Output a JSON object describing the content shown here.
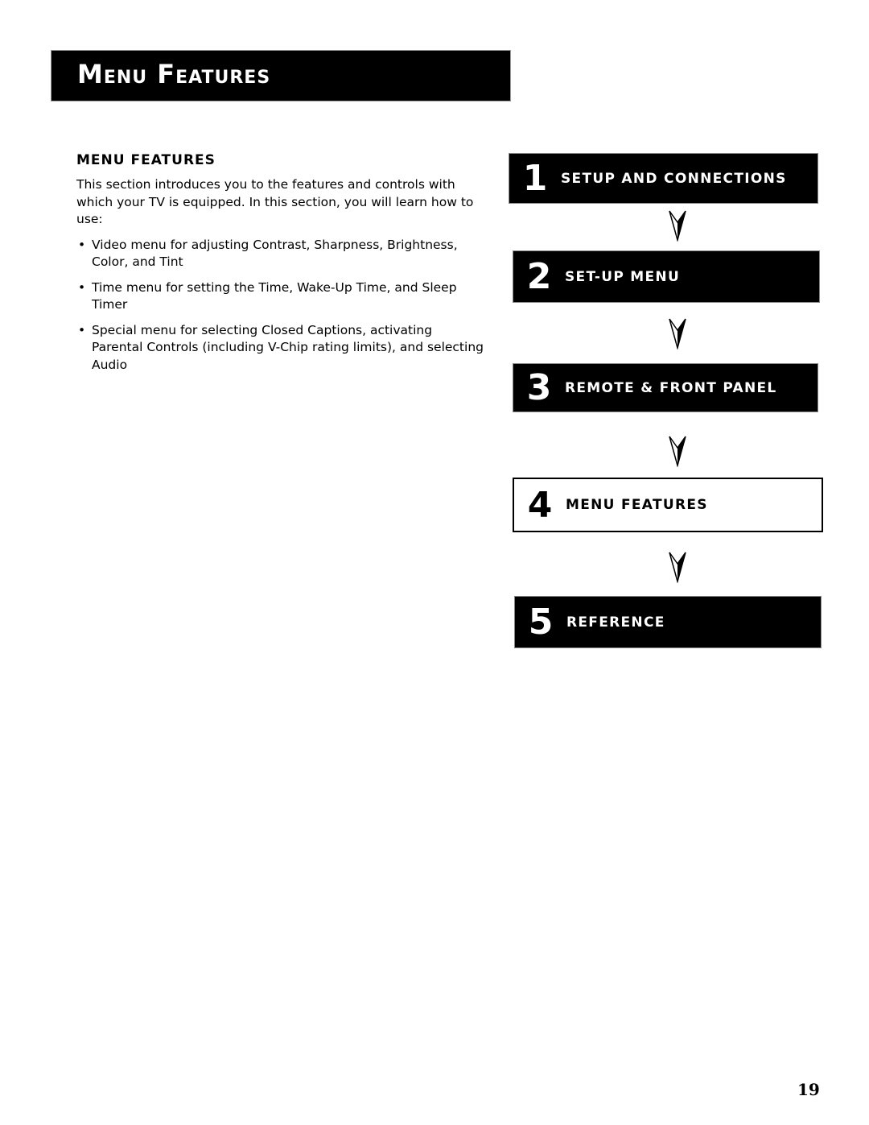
{
  "header": {
    "title": "Menu Features"
  },
  "content": {
    "heading": "Menu Features",
    "intro": "This section introduces you to the features and controls with which your TV is equipped. In this section, you will learn how to use:",
    "bullet_glyph": "•",
    "bullets": [
      "Video menu for adjusting Contrast, Sharpness, Brightness, Color, and Tint",
      "Time menu for setting the Time, Wake-Up Time, and Sleep Timer",
      "Special menu for selecting Closed Captions, activating Parental Controls (including V-Chip rating limits), and selecting Audio"
    ]
  },
  "flow": {
    "arrow_icon": "down-arrowhead-icon",
    "steps": [
      {
        "number": "1",
        "label": "Setup and Connections",
        "current": false
      },
      {
        "number": "2",
        "label": "Set-Up Menu",
        "current": false
      },
      {
        "number": "3",
        "label": "Remote & Front Panel",
        "current": false
      },
      {
        "number": "4",
        "label": "Menu Features",
        "current": true
      },
      {
        "number": "5",
        "label": "Reference",
        "current": false
      }
    ]
  },
  "footer": {
    "page_number": "19"
  },
  "colors": {
    "dark_box": "#000000",
    "text": "#000000",
    "inverse_text": "#ffffff"
  }
}
